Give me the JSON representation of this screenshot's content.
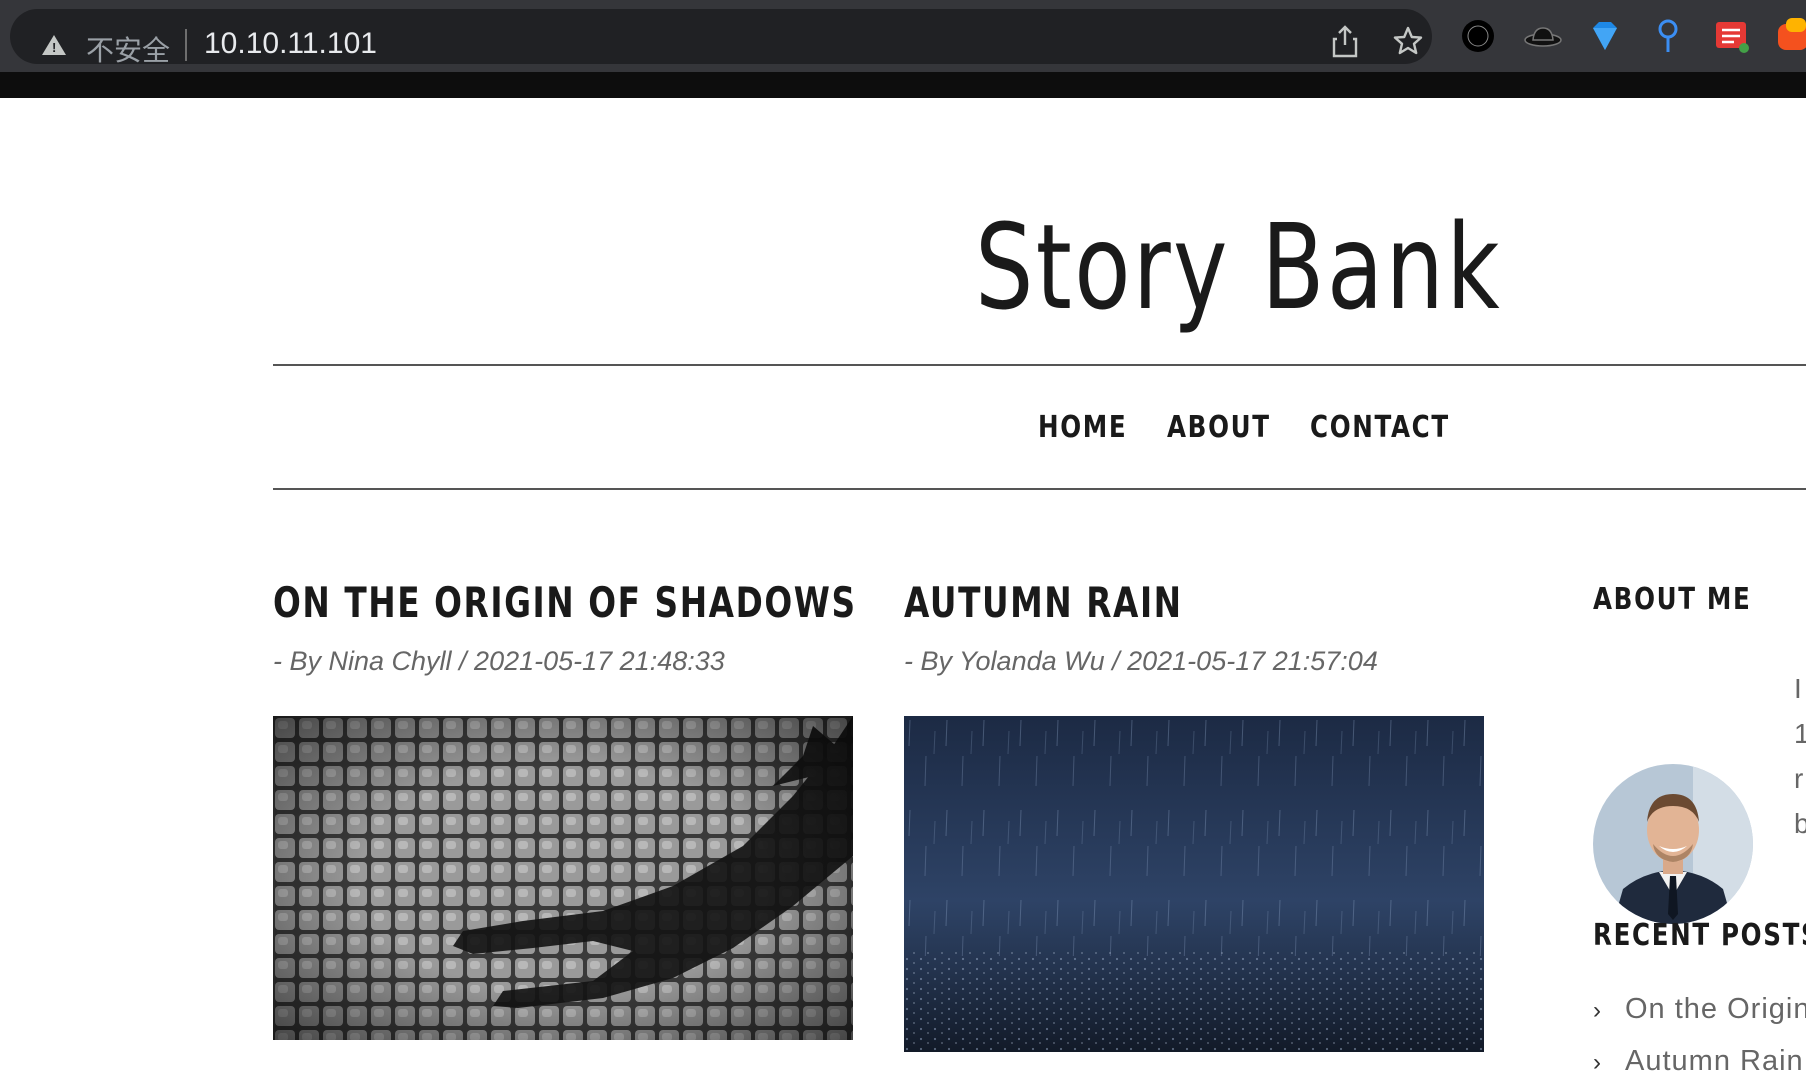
{
  "browser": {
    "insecure_label": "不安全",
    "url": "10.10.11.101",
    "share_icon": "share-icon",
    "bookmark_icon": "star-icon",
    "extensions": [
      "circle-extension-icon",
      "hat-extension-icon",
      "diamond-extension-icon",
      "pin-extension-icon",
      "list-extension-icon",
      "orange-extension-icon"
    ]
  },
  "site": {
    "title": "Story Bank",
    "nav": [
      "HOME",
      "ABOUT",
      "CONTACT"
    ]
  },
  "posts": [
    {
      "title": "ON THE ORIGIN OF SHADOWS",
      "meta": "- By Nina Chyll / 2021-05-17 21:48:33"
    },
    {
      "title": "AUTUMN RAIN",
      "meta": "- By Yolanda Wu / 2021-05-17 21:57:04"
    }
  ],
  "sidebar": {
    "about_heading": "ABOUT ME",
    "about_text_fragments": [
      "I",
      "1",
      "r",
      "b"
    ],
    "recent_heading": "RECENT POSTS",
    "recent_posts": [
      "On the Origin",
      "Autumn Rain"
    ]
  },
  "colors": {
    "chrome": "#35363a",
    "omnibox": "#202124",
    "text_dark": "#1a1a1a",
    "meta_gray": "#666666"
  }
}
